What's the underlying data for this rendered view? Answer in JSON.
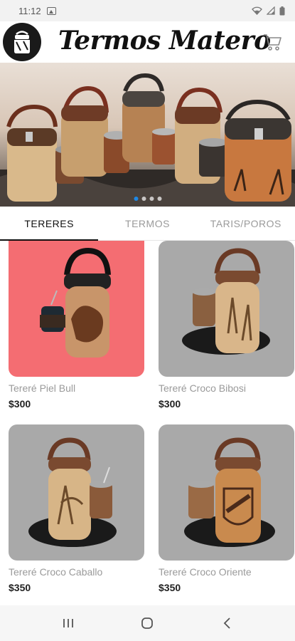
{
  "status_bar": {
    "time": "11:12",
    "icons": [
      "image-icon",
      "wifi-icon",
      "signal-icon",
      "battery-icon"
    ]
  },
  "app_bar": {
    "title": "Termos Matero",
    "logo": "termos-matero-logo",
    "cart_icon": "shopping-cart-icon"
  },
  "banner": {
    "description_icon": "product-banner-image",
    "slide_count": 4,
    "active_slide": 1
  },
  "tabs": [
    {
      "label": "TERERES",
      "active": true
    },
    {
      "label": "TERMOS",
      "active": false
    },
    {
      "label": "TARIS/POROS",
      "active": false
    }
  ],
  "products": [
    {
      "name": "Tereré Piel Bull",
      "price": "$300",
      "bg": "#f46d72"
    },
    {
      "name": "Tereré Croco Bibosi",
      "price": "$300",
      "bg": "#a9a9a9"
    },
    {
      "name": "Tereré Croco Caballo",
      "price": "$350",
      "bg": "#a9a9a9"
    },
    {
      "name": "Tereré Croco Oriente",
      "price": "$350",
      "bg": "#a9a9a9"
    }
  ],
  "nav_bar": {
    "icons": [
      "recents-icon",
      "home-icon",
      "back-icon"
    ]
  },
  "colors": {
    "accent_pink": "#f46d72",
    "card_gray": "#a9a9a9",
    "indicator_blue": "#1e88e5"
  }
}
